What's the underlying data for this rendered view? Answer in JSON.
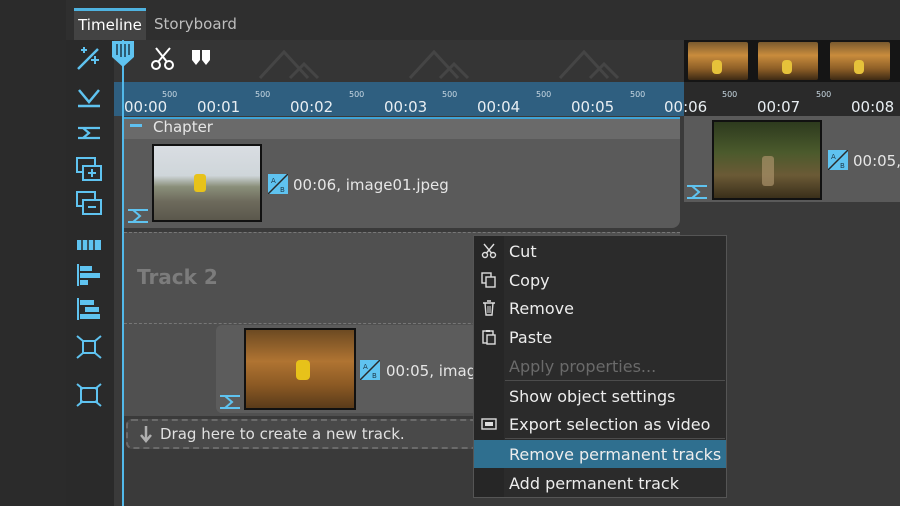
{
  "tabs": [
    {
      "label": "Timeline",
      "active": true
    },
    {
      "label": "Storyboard",
      "active": false
    }
  ],
  "ruler": {
    "labels": [
      "00:00",
      "00:01",
      "00:02",
      "00:03",
      "00:04",
      "00:05",
      "00:06",
      "00:07",
      "00:08"
    ],
    "sub_label": "500"
  },
  "chapter": {
    "label": "Chapter"
  },
  "track1": {
    "clip_text": "00:06, image01.jpeg"
  },
  "track2": {
    "label": "Track 2"
  },
  "track3": {
    "clip_text": "00:05, image"
  },
  "right_clip": {
    "clip_text": "00:05,"
  },
  "dragzone": {
    "text": "Drag here to create a new track."
  },
  "context_menu": {
    "items": [
      {
        "label": "Cut",
        "icon": "scissors-icon",
        "disabled": false
      },
      {
        "label": "Copy",
        "icon": "copy-icon",
        "disabled": false
      },
      {
        "label": "Remove",
        "icon": "trash-icon",
        "disabled": false
      },
      {
        "label": "Paste",
        "icon": "paste-icon",
        "disabled": false
      },
      {
        "label": "Apply properties...",
        "icon": "",
        "disabled": true
      },
      {
        "label": "Show object settings",
        "icon": "",
        "disabled": false
      },
      {
        "label": "Export selection as video",
        "icon": "video-export-icon",
        "disabled": false
      },
      {
        "label": "Remove permanent tracks",
        "icon": "",
        "disabled": false,
        "highlighted": true
      },
      {
        "label": "Add permanent track",
        "icon": "",
        "disabled": false
      }
    ]
  },
  "colors": {
    "accent": "#52b9ea",
    "highlight": "#2f6f8f",
    "ruler": "#2f5f80"
  }
}
